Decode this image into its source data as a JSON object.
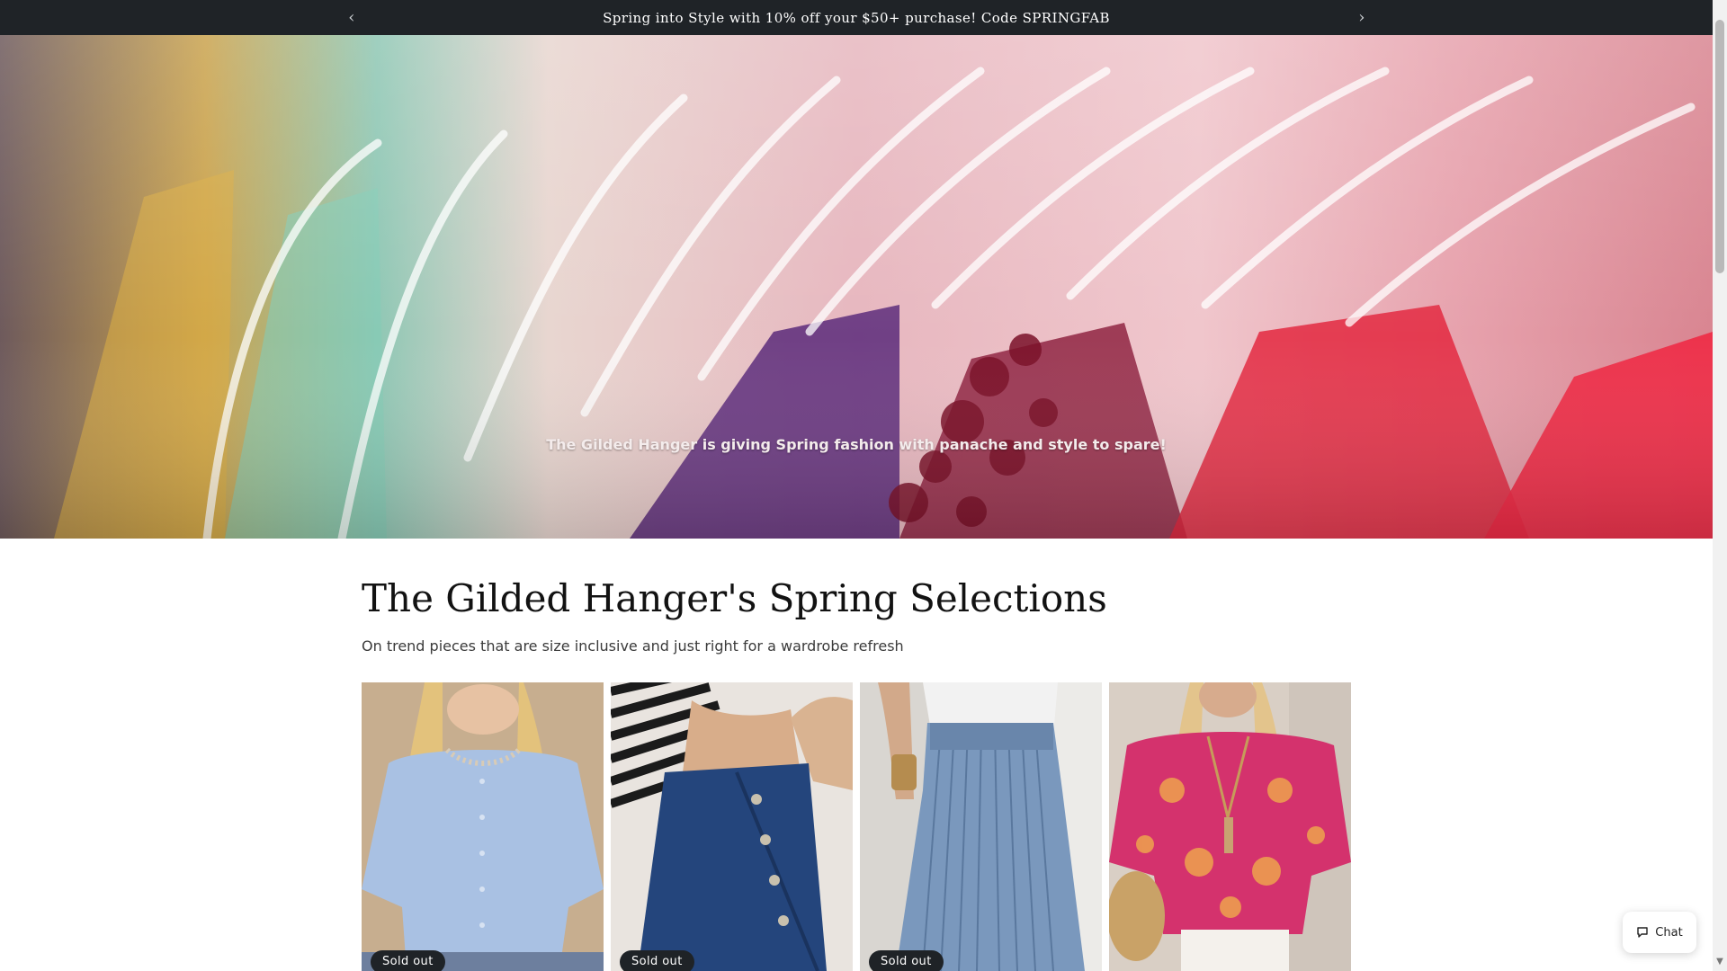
{
  "announcement": {
    "text": "Spring into Style with 10% off your $50+ purchase! Code SPRINGFAB",
    "prev_icon": "chevron-left-icon",
    "next_icon": "chevron-right-icon"
  },
  "hero": {
    "caption": "The Gilded Hanger is giving Spring fashion with panache and style to spare!"
  },
  "collection": {
    "title": "The Gilded Hanger's Spring Selections",
    "subtitle": "On trend pieces that are size inclusive and just right for a wardrobe refresh"
  },
  "products": [
    {
      "badge": "Sold out",
      "color": "#9fb6d8"
    },
    {
      "badge": "Sold out",
      "color": "#2c4b7e"
    },
    {
      "badge": "Sold out",
      "color": "#6f8fb2"
    },
    {
      "badge": "",
      "color": "#d4326d"
    }
  ],
  "chat": {
    "label": "Chat",
    "icon": "chat-bubble-icon"
  }
}
